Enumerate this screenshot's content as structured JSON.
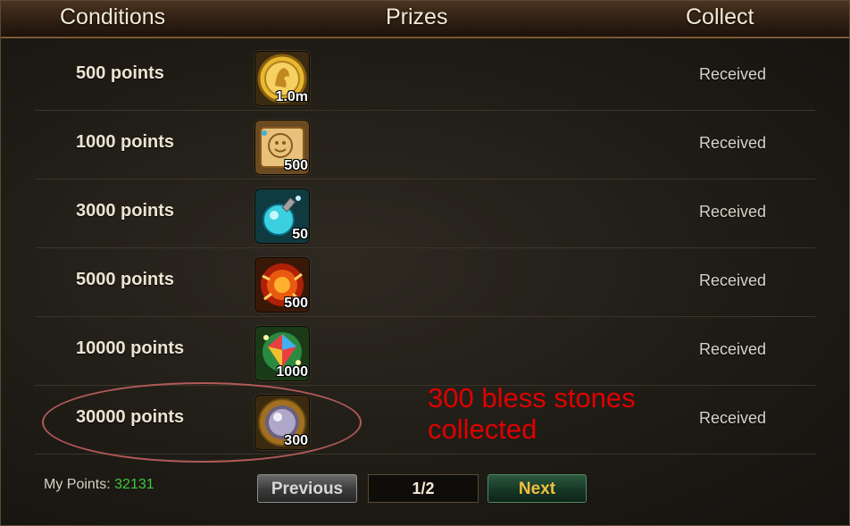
{
  "header": {
    "conditions": "Conditions",
    "prizes": "Prizes",
    "collect": "Collect"
  },
  "rows": [
    {
      "condition": "500 points",
      "qty": "1.0m",
      "status": "Received",
      "icon": "gold-coin-icon"
    },
    {
      "condition": "1000 points",
      "qty": "500",
      "status": "Received",
      "icon": "scroll-face-icon"
    },
    {
      "condition": "3000 points",
      "qty": "50",
      "status": "Received",
      "icon": "blue-potion-icon"
    },
    {
      "condition": "5000 points",
      "qty": "500",
      "status": "Received",
      "icon": "fire-orb-icon"
    },
    {
      "condition": "10000 points",
      "qty": "1000",
      "status": "Received",
      "icon": "rainbow-gem-icon"
    },
    {
      "condition": "30000 points",
      "qty": "300",
      "status": "Received",
      "icon": "bless-stone-icon"
    }
  ],
  "annotation": {
    "line1": "300 bless stones",
    "line2": "collected",
    "color": "#e00000"
  },
  "footer": {
    "points_label": "My Points:",
    "points_value": "32131",
    "prev_label": "Previous",
    "page": "1/2",
    "next_label": "Next"
  },
  "colors": {
    "points_value": "#3fc93f",
    "next_text": "#f0c040",
    "header_border": "#7a5a32"
  }
}
